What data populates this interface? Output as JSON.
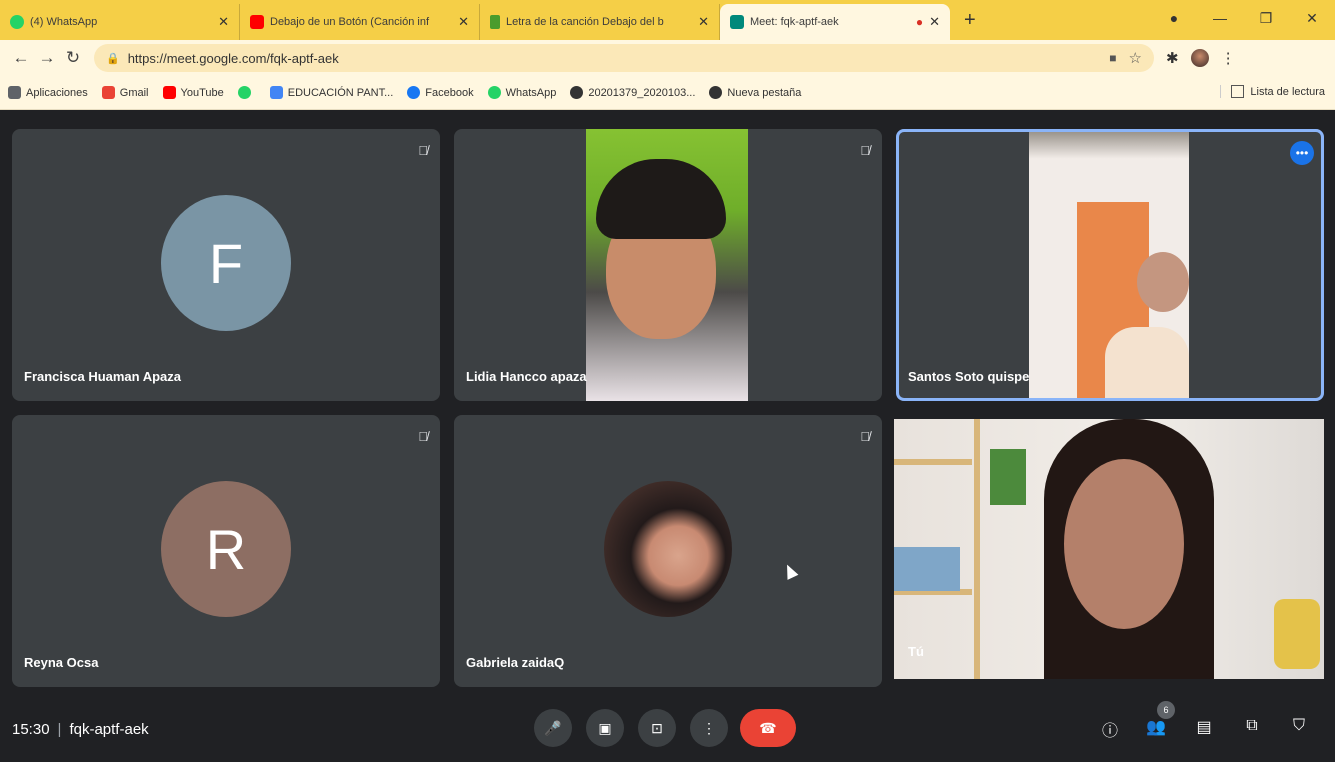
{
  "browser": {
    "tabs": [
      {
        "title": "(4) WhatsApp",
        "color": "#25d366",
        "active": false
      },
      {
        "title": "Debajo de un Botón (Canción inf",
        "color": "#ff0000",
        "active": false
      },
      {
        "title": "Letra de la canción Debajo del b",
        "color": "#4a9c2d",
        "active": false
      },
      {
        "title": "Meet: fqk-aptf-aek",
        "color": "#00897b",
        "active": true
      }
    ],
    "recording_tab": "●",
    "url": "https://meet.google.com/fqk-aptf-aek",
    "bookmarks": [
      {
        "label": "Aplicaciones",
        "color": "#5f6368"
      },
      {
        "label": "Gmail",
        "color": "#ea4335"
      },
      {
        "label": "YouTube",
        "color": "#ff0000"
      },
      {
        "label": "",
        "color": "#25d366"
      },
      {
        "label": "EDUCACIÓN PANT...",
        "color": "#4285f4"
      },
      {
        "label": "Facebook",
        "color": "#1877f2"
      },
      {
        "label": "WhatsApp",
        "color": "#25d366"
      },
      {
        "label": "20201379_2020103...",
        "color": "#333333"
      },
      {
        "label": "Nueva pestaña",
        "color": "#333333"
      }
    ],
    "reading_list": "Lista de lectura"
  },
  "meet": {
    "participants": [
      {
        "name": "Francisca Huaman Apaza",
        "initial": "F",
        "avatar_color": "#7a95a5"
      },
      {
        "name": "Lidia Hancco apaza"
      },
      {
        "name": "Santos Soto quispe"
      },
      {
        "name": "Reyna Ocsa",
        "initial": "R",
        "avatar_color": "#8d6e63"
      },
      {
        "name": "Gabriela zaidaQ"
      },
      {
        "name": "Tú"
      }
    ],
    "time": "15:30",
    "meeting_code": "fqk-aptf-aek",
    "participant_count": "6"
  }
}
